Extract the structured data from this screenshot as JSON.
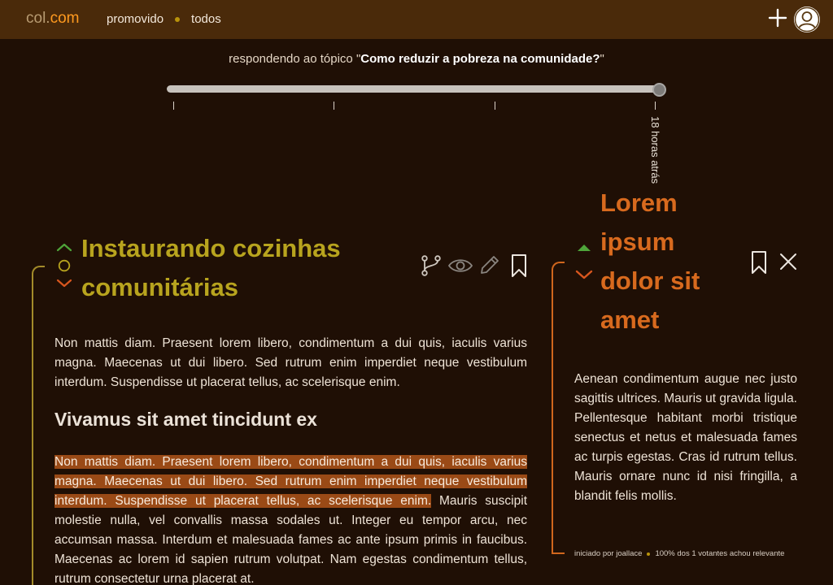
{
  "header": {
    "logo_part1": "col.",
    "logo_part2": "com",
    "nav": [
      "promovido",
      "todos"
    ]
  },
  "topic": {
    "prefix": "respondendo ao tópico \"",
    "title": "Como reduzir a pobreza na comunidade?",
    "suffix": "\""
  },
  "timeline": {
    "label": "18 horas atrás",
    "position": 1.0
  },
  "left_post": {
    "title": "Instaurando cozinhas comunitárias",
    "paragraph1": "Non mattis diam. Praesent lorem libero, condimentum a dui quis, iaculis varius magna. Maecenas ut dui libero. Sed rutrum enim imperdiet neque vestibulum interdum. Suspendisse ut placerat tellus, ac scelerisque enim.",
    "subheading": "Vivamus sit amet tincidunt ex",
    "paragraph2_highlight": "Non mattis diam. Praesent lorem libero, condimentum a dui quis, iaculis varius magna. Maecenas ut dui libero. Sed rutrum enim imperdiet neque vestibulum interdum. Suspendisse ut placerat tellus, ac scelerisque enim.",
    "paragraph2_rest": " Mauris suscipit molestie nulla, vel convallis massa sodales ut. Integer eu tempor arcu, nec accumsan massa. Interdum et malesuada fames ac ante ipsum primis in faucibus. Maecenas ac lorem id sapien rutrum volutpat. Nam egestas condimentum tellus, rutrum consectetur urna placerat at."
  },
  "right_post": {
    "title": "Lorem ipsum dolor sit amet",
    "body": "Aenean condimentum augue nec justo sagittis ultrices. Mauris ut gravida ligula. Pellentesque habitant morbi tristique senectus et netus et malesuada fames ac turpis egestas. Cras id rutrum tellus. Mauris ornare nunc id nisi fringilla, a blandit felis mollis.",
    "started_by": "iniciado por joallace",
    "relevance": "100% dos 1 votantes achou relevante"
  },
  "colors": {
    "background": "#1f0f05",
    "header": "#4a2a0a",
    "left_accent": "#b8a41e",
    "right_accent": "#d86a1e",
    "highlight": "#9a4a16"
  },
  "icons": [
    "plus-icon",
    "user-icon",
    "branch-icon",
    "eye-icon",
    "pencil-icon",
    "bookmark-icon",
    "close-icon",
    "chevron-up-icon",
    "circle-icon",
    "chevron-down-icon",
    "triangle-up-icon"
  ]
}
